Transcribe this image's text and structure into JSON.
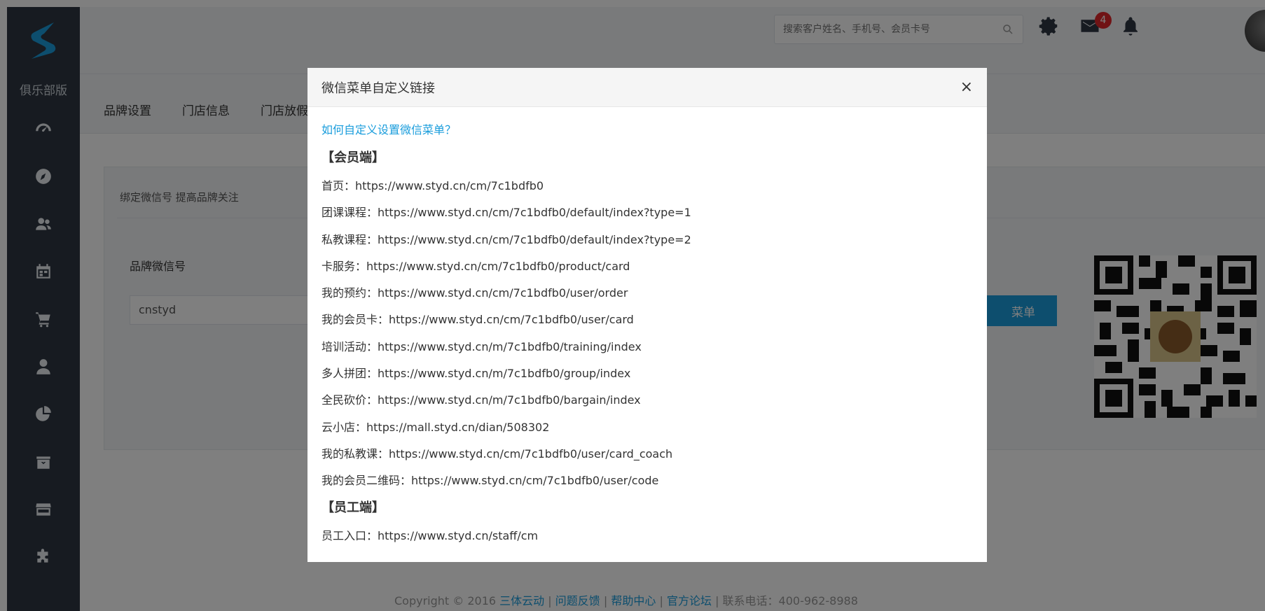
{
  "sidebar": {
    "club_label": "俱乐部版",
    "items": [
      {
        "icon": "dashboard-icon"
      },
      {
        "icon": "compass-icon"
      },
      {
        "icon": "users-icon"
      },
      {
        "icon": "calendar-icon"
      },
      {
        "icon": "cart-icon"
      },
      {
        "icon": "user-icon"
      },
      {
        "icon": "pie-chart-icon"
      },
      {
        "icon": "finance-icon"
      },
      {
        "icon": "store-icon"
      },
      {
        "icon": "puzzle-icon"
      }
    ]
  },
  "header": {
    "search_placeholder": "搜索客户姓名、手机号、会员卡号",
    "notification_count": "4"
  },
  "tabs": [
    "品牌设置",
    "门店信息",
    "门店放假"
  ],
  "panel": {
    "hint": "绑定微信号 提高品牌关注",
    "wechat_label": "品牌微信号",
    "wechat_value": "cnstyd",
    "menu_button": "菜单"
  },
  "footer": {
    "copyright": "Copyright © 2016",
    "links": [
      "三体云动",
      "问题反馈",
      "帮助中心",
      "官方论坛"
    ],
    "separator": "|",
    "phone": "联系电话：400-962-8988"
  },
  "modal": {
    "title": "微信菜单自定义链接",
    "close": "×",
    "help_link": "如何自定义设置微信菜单？",
    "member_section": "【会员端】",
    "member_links": [
      "首页：https://www.styd.cn/cm/7c1bdfb0",
      "团课课程：https://www.styd.cn/cm/7c1bdfb0/default/index?type=1",
      "私教课程：https://www.styd.cn/cm/7c1bdfb0/default/index?type=2",
      "卡服务：https://www.styd.cn/cm/7c1bdfb0/product/card",
      "我的预约：https://www.styd.cn/cm/7c1bdfb0/user/order",
      "我的会员卡：https://www.styd.cn/cm/7c1bdfb0/user/card",
      "培训活动：https://www.styd.cn/m/7c1bdfb0/training/index",
      "多人拼团：https://www.styd.cn/m/7c1bdfb0/group/index",
      "全民砍价：https://www.styd.cn/m/7c1bdfb0/bargain/index",
      "云小店：https://mall.styd.cn/dian/508302",
      "我的私教课：https://www.styd.cn/cm/7c1bdfb0/user/card_coach",
      "我的会员二维码：https://www.styd.cn/cm/7c1bdfb0/user/code"
    ],
    "staff_section": "【员工端】",
    "staff_links": [
      "员工入口：https://www.styd.cn/staff/cm"
    ]
  },
  "colors": {
    "sidebar_bg": "#2f3742",
    "accent": "#1a9ddc",
    "badge": "#e0272b"
  }
}
